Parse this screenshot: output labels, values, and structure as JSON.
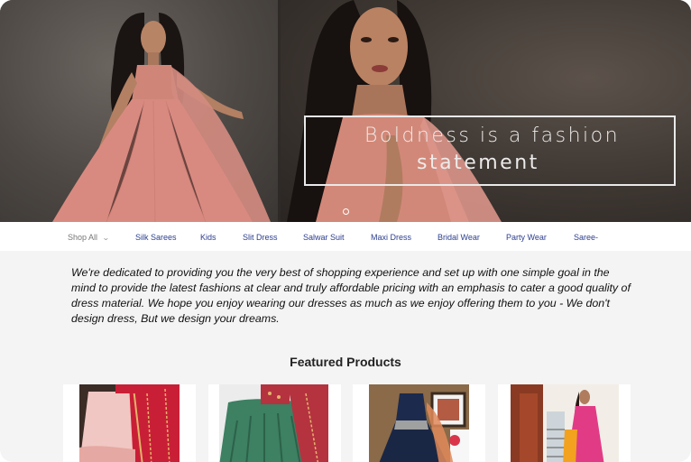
{
  "hero": {
    "caption_line1": "Boldness is a fashion",
    "caption_line2": "statement"
  },
  "nav": {
    "items": [
      {
        "label": "Shop All"
      },
      {
        "label": "Silk Sarees"
      },
      {
        "label": "Kids"
      },
      {
        "label": "Slit Dress"
      },
      {
        "label": "Salwar Suit"
      },
      {
        "label": "Maxi Dress"
      },
      {
        "label": "Bridal Wear"
      },
      {
        "label": "Party Wear"
      },
      {
        "label": "Saree-"
      }
    ]
  },
  "about": {
    "text": "We're dedicated to providing you the very best of shopping experience and set up with one simple goal in the mind to provide the latest fashions at clear and truly affordable pricing with an emphasis to cater a good quality of dress material. We hope you enjoy wearing our dresses as much as we enjoy offering them to you - We don't design dress, But we design your dreams."
  },
  "featured": {
    "title": "Featured Products"
  },
  "colors": {
    "nav_link": "#2c3e8f",
    "gown": "#d98a80",
    "background": "#f4f4f4"
  }
}
